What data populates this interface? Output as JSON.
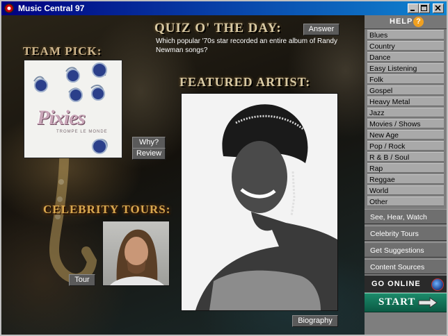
{
  "window": {
    "title": "Music Central 97"
  },
  "quiz": {
    "heading": "QUIZ O' THE DAY:",
    "question": "Which popular '70s star recorded an entire album of Randy Newman songs?",
    "answer_button": "Answer"
  },
  "team_pick": {
    "heading": "TEAM PICK:",
    "album_title": "Pixies",
    "album_subtitle": "TROMPE LE MONDE",
    "why_button": "Why?",
    "review_button": "Review"
  },
  "featured_artist": {
    "heading": "FEATURED ARTIST:",
    "biography_button": "Biography"
  },
  "celebrity_tours": {
    "heading": "CELEBRITY TOURS:",
    "tour_button": "Tour"
  },
  "sidebar": {
    "help_label": "HELP",
    "help_icon": "?",
    "genres": [
      "Blues",
      "Country",
      "Dance",
      "Easy Listening",
      "Folk",
      "Gospel",
      "Heavy Metal",
      "Jazz",
      "Movies / Shows",
      "New Age",
      "Pop / Rock",
      "R & B / Soul",
      "Rap",
      "Reggae",
      "World",
      "Other"
    ],
    "nav": [
      "See, Hear, Watch",
      "Celebrity Tours",
      "Get Suggestions",
      "Content Sources"
    ],
    "go_online": "GO ONLINE",
    "start": "START"
  },
  "colors": {
    "title_bar": "#000080",
    "start": "#1b8a6a",
    "help_badge": "#f0a020"
  }
}
